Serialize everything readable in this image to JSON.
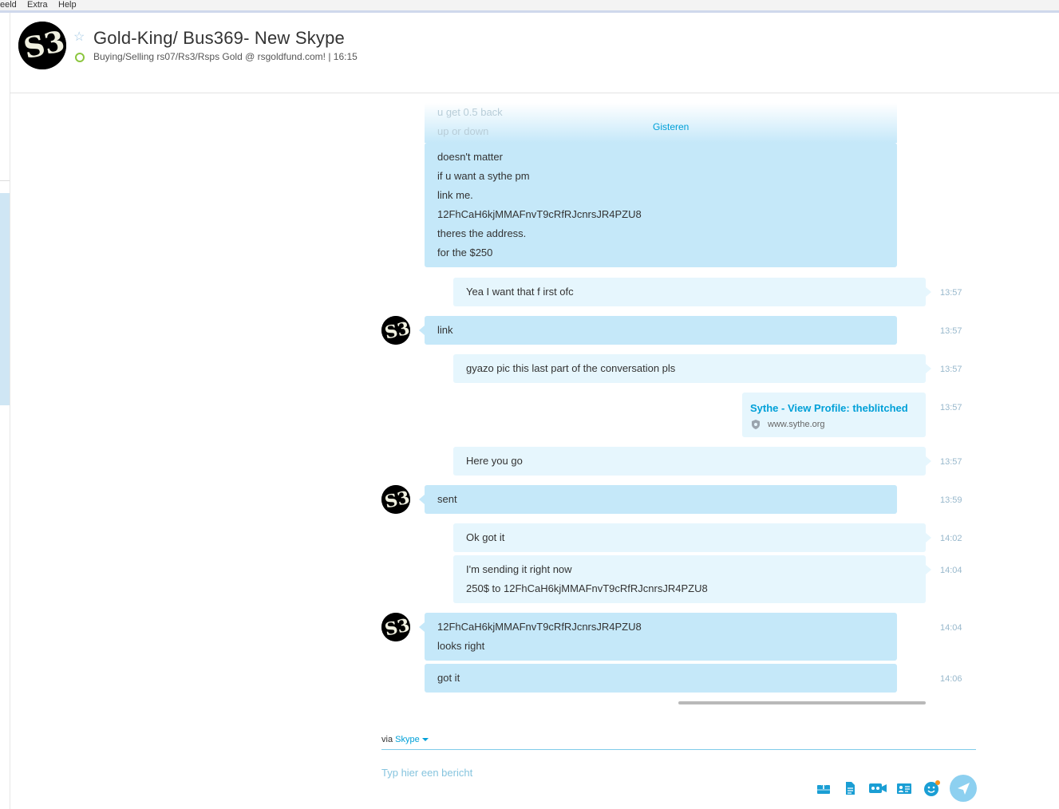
{
  "menu": {
    "items": [
      "eeld",
      "Extra",
      "Help"
    ]
  },
  "header": {
    "title": "Gold-King/ Bus369- New Skype",
    "mood": "Buying/Selling rs07/Rs3/Rsps Gold @ rsgoldfund.com!",
    "separator": "|",
    "local_time": "16:15"
  },
  "chat": {
    "day_divider": "Gisteren",
    "faded_lines": [
      "u get 0.5 back",
      "up or down"
    ],
    "messages": [
      {
        "from": "contact",
        "lines": [
          "doesn't matter",
          "if u want a sythe pm",
          "link me.",
          "12FhCaH6kjMMAFnvT9cRfRJcnrsJR4PZU8",
          "theres the address.",
          "for the $250"
        ],
        "time": ""
      },
      {
        "from": "me",
        "lines": [
          "Yea I want that f irst ofc"
        ],
        "time": "13:57"
      },
      {
        "from": "contact",
        "lines": [
          "link"
        ],
        "time": "13:57"
      },
      {
        "from": "me",
        "lines": [
          "gyazo pic this last part of the conversation pls"
        ],
        "time": "13:57"
      },
      {
        "from": "me",
        "link": {
          "title": "Sythe - View Profile: theblitched",
          "url": "www.sythe.org"
        },
        "time": "13:57"
      },
      {
        "from": "me",
        "lines": [
          "Here you go"
        ],
        "time": "13:57"
      },
      {
        "from": "contact",
        "lines": [
          "sent"
        ],
        "time": "13:59"
      },
      {
        "from": "me",
        "lines": [
          "Ok got it"
        ],
        "time": "14:02"
      },
      {
        "from": "me",
        "lines": [
          "I'm sending it right now",
          "250$ to 12FhCaH6kjMMAFnvT9cRfRJcnrsJR4PZU8"
        ],
        "time": "14:04"
      },
      {
        "from": "contact",
        "lines": [
          "12FhCaH6kjMMAFnvT9cRfRJcnrsJR4PZU8",
          "looks right"
        ],
        "time": "14:04"
      },
      {
        "from": "contact",
        "lines": [
          "got it"
        ],
        "time": "14:06"
      }
    ]
  },
  "composer": {
    "via_label": "via",
    "via_service": "Skype",
    "placeholder": "Typ hier een bericht",
    "tools": [
      "send-file-icon",
      "send-document-icon",
      "video-message-icon",
      "contact-card-icon",
      "emoticon-icon"
    ],
    "send_icon": "send-arrow-icon"
  },
  "colors": {
    "incoming": "#c5e8f9",
    "outgoing": "#e6f6fd",
    "accent": "#00a0d8",
    "status_online": "#8cc63f"
  }
}
